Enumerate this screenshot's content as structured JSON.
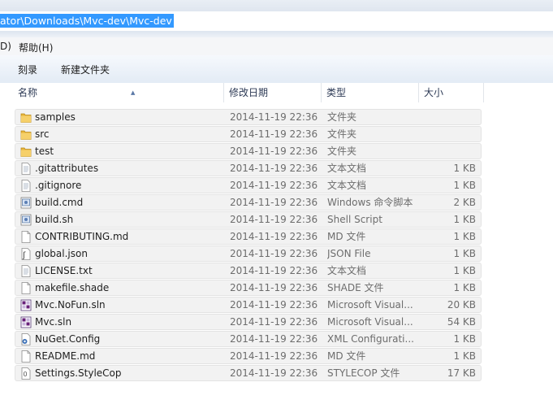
{
  "address": {
    "path": "ator\\Downloads\\Mvc-dev\\Mvc-dev"
  },
  "menu": {
    "items": [
      "D)",
      "帮助(H)"
    ]
  },
  "toolbar": {
    "burn": "刻录",
    "new_folder": "新建文件夹"
  },
  "columns": {
    "name": "名称",
    "date": "修改日期",
    "type": "类型",
    "size": "大小"
  },
  "files": [
    {
      "name": "samples",
      "date": "2014-11-19 22:36",
      "type": "文件夹",
      "size": "",
      "icon": "folder-icon"
    },
    {
      "name": "src",
      "date": "2014-11-19 22:36",
      "type": "文件夹",
      "size": "",
      "icon": "folder-icon"
    },
    {
      "name": "test",
      "date": "2014-11-19 22:36",
      "type": "文件夹",
      "size": "",
      "icon": "folder-icon"
    },
    {
      "name": ".gitattributes",
      "date": "2014-11-19 22:36",
      "type": "文本文档",
      "size": "1 KB",
      "icon": "text-file-icon"
    },
    {
      "name": ".gitignore",
      "date": "2014-11-19 22:36",
      "type": "文本文档",
      "size": "1 KB",
      "icon": "text-file-icon"
    },
    {
      "name": "build.cmd",
      "date": "2014-11-19 22:36",
      "type": "Windows 命令脚本",
      "size": "2 KB",
      "icon": "script-file-icon"
    },
    {
      "name": "build.sh",
      "date": "2014-11-19 22:36",
      "type": "Shell Script",
      "size": "1 KB",
      "icon": "script-file-icon"
    },
    {
      "name": "CONTRIBUTING.md",
      "date": "2014-11-19 22:36",
      "type": "MD 文件",
      "size": "1 KB",
      "icon": "blank-file-icon"
    },
    {
      "name": "global.json",
      "date": "2014-11-19 22:36",
      "type": "JSON File",
      "size": "1 KB",
      "icon": "json-file-icon"
    },
    {
      "name": "LICENSE.txt",
      "date": "2014-11-19 22:36",
      "type": "文本文档",
      "size": "1 KB",
      "icon": "text-file-icon"
    },
    {
      "name": "makefile.shade",
      "date": "2014-11-19 22:36",
      "type": "SHADE 文件",
      "size": "1 KB",
      "icon": "blank-file-icon"
    },
    {
      "name": "Mvc.NoFun.sln",
      "date": "2014-11-19 22:36",
      "type": "Microsoft Visual...",
      "size": "20 KB",
      "icon": "solution-file-icon"
    },
    {
      "name": "Mvc.sln",
      "date": "2014-11-19 22:36",
      "type": "Microsoft Visual...",
      "size": "54 KB",
      "icon": "solution-file-icon"
    },
    {
      "name": "NuGet.Config",
      "date": "2014-11-19 22:36",
      "type": "XML Configurati...",
      "size": "1 KB",
      "icon": "config-file-icon"
    },
    {
      "name": "README.md",
      "date": "2014-11-19 22:36",
      "type": "MD 文件",
      "size": "1 KB",
      "icon": "blank-file-icon"
    },
    {
      "name": "Settings.StyleCop",
      "date": "2014-11-19 22:36",
      "type": "STYLECOP 文件",
      "size": "17 KB",
      "icon": "stylecop-file-icon"
    }
  ]
}
